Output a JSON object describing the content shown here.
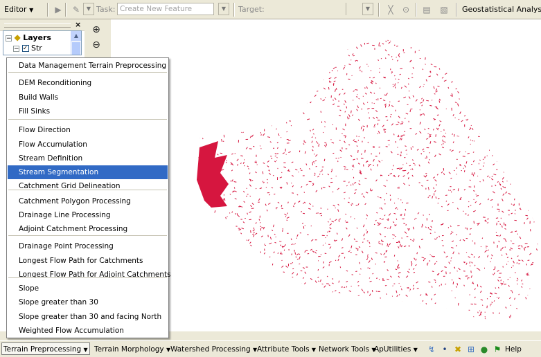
{
  "editor_toolbar": {
    "editor_label": "Editor",
    "task_label": "Task:",
    "task_value": "Create New Feature",
    "target_label": "Target:",
    "target_value": "",
    "geostat_label": "Geostatistical Analyst"
  },
  "toc": {
    "root_label": "Layers",
    "layer_label": "Str"
  },
  "menu": {
    "selected_index": 8,
    "items": [
      {
        "label": "Data Management Terrain Preprocessing"
      },
      {
        "label": "DEM Reconditioning"
      },
      {
        "label": "Build Walls"
      },
      {
        "label": "Fill Sinks"
      },
      {
        "label": "Flow Direction"
      },
      {
        "label": "Flow Accumulation"
      },
      {
        "label": "Stream Definition"
      },
      {
        "label": "Stream Segmentation"
      },
      {
        "label": "Catchment Grid Delineation"
      },
      {
        "label": "Catchment Polygon Processing"
      },
      {
        "label": "Drainage Line Processing"
      },
      {
        "label": "Adjoint Catchment Processing"
      },
      {
        "label": "Drainage Point Processing"
      },
      {
        "label": "Longest Flow Path for Catchments"
      },
      {
        "label": "Longest Flow Path for Adjoint Catchments"
      },
      {
        "label": "Slope"
      },
      {
        "label": "Slope greater than 30"
      },
      {
        "label": "Slope greater than 30 and facing North"
      },
      {
        "label": "Weighted Flow Accumulation"
      }
    ]
  },
  "bottom_toolbar": {
    "terrain_preprocessing": "Terrain Preprocessing",
    "terrain_morphology": "Terrain Morphology",
    "watershed_processing": "Watershed Processing",
    "attribute_tools": "Attribute Tools",
    "network_tools": "Network Tools",
    "ap_utilities": "ApUtilities",
    "help": "Help"
  },
  "colors": {
    "stream_red": "#d6163f",
    "menu_highlight": "#316ac5",
    "toolbar_bg": "#ece9d8"
  }
}
